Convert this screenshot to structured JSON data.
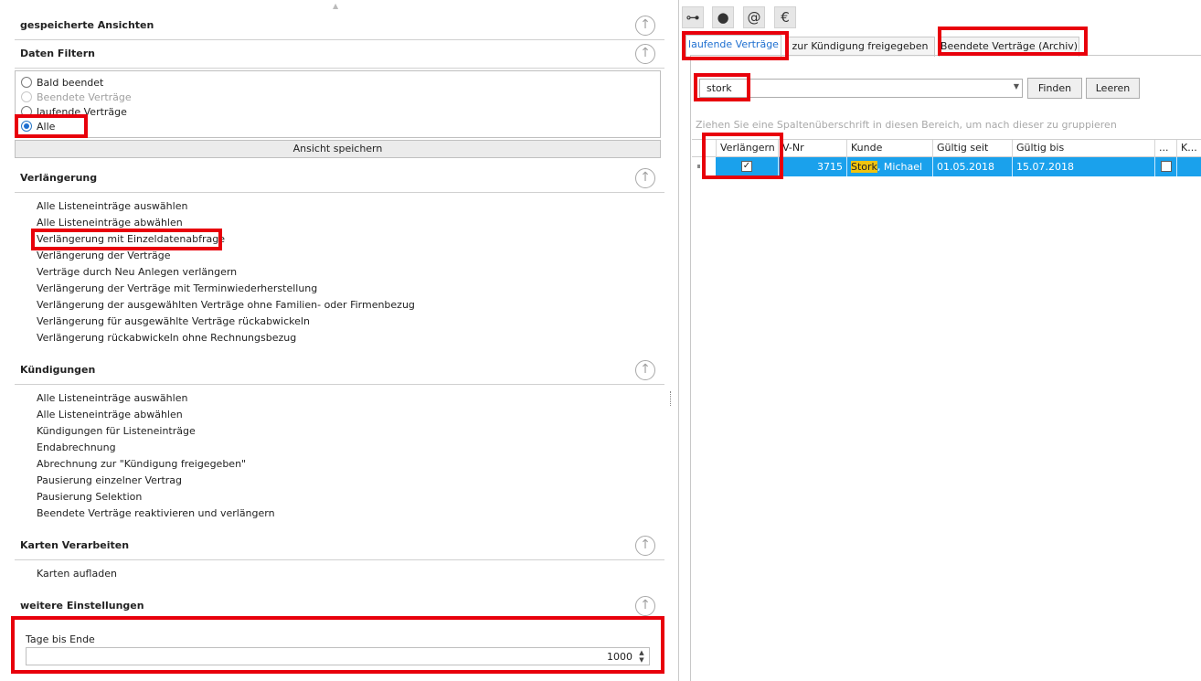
{
  "left_panel": {
    "sections": {
      "saved_views": {
        "title": "gespeicherte Ansichten"
      },
      "data_filter": {
        "title": "Daten Filtern",
        "options": [
          "Bald beendet",
          "Beendete Verträge",
          "laufende Verträge",
          "Alle"
        ],
        "selected": "Alle",
        "disabled": [
          "Beendete Verträge"
        ],
        "save_view_label": "Ansicht speichern"
      },
      "renewal": {
        "title": "Verlängerung",
        "items": [
          "Alle Listeneinträge auswählen",
          "Alle Listeneinträge abwählen",
          "Verlängerung mit Einzeldatenabfrage",
          "Verlängerung der Verträge",
          "Verträge durch Neu Anlegen verlängern",
          "Verlängerung der Verträge mit Terminwiederherstellung",
          "Verlängerung der ausgewählten Verträge ohne Familien- oder Firmenbezug",
          "Verlängerung für ausgewählte Verträge rückabwickeln",
          "Verlängerung rückabwickeln ohne Rechnungsbezug"
        ]
      },
      "cancellations": {
        "title": "Kündigungen",
        "items": [
          "Alle Listeneinträge auswählen",
          "Alle Listeneinträge abwählen",
          "Kündigungen für Listeneinträge",
          "Endabrechnung",
          "Abrechnung zur \"Kündigung freigegeben\"",
          "Pausierung einzelner Vertrag",
          "Pausierung Selektion",
          "Beendete Verträge reaktivieren und verlängern"
        ]
      },
      "cards": {
        "title": "Karten Verarbeiten",
        "items": [
          "Karten aufladen"
        ]
      },
      "more_settings": {
        "title": "weitere Einstellungen",
        "days_label": "Tage bis Ende",
        "days_value": "1000"
      }
    },
    "collapse_glyph": "↑"
  },
  "right_panel": {
    "toolbar_icons": [
      "org-chart-icon",
      "user-icon",
      "at-icon",
      "euro-icon"
    ],
    "toolbar_glyphs": [
      "⊶",
      "●",
      "@",
      "€"
    ],
    "tabs": [
      "laufende Verträge",
      "zur Kündigung freigegeben",
      "Beendete Verträge (Archiv)"
    ],
    "active_tab": "laufende Verträge",
    "search": {
      "value": "stork",
      "find_label": "Finden",
      "clear_label": "Leeren"
    },
    "group_hint": "Ziehen Sie eine Spaltenüberschrift in diesen Bereich, um nach dieser zu gruppieren",
    "grid": {
      "columns": [
        "Verlängern",
        "V-Nr",
        "Kunde",
        "Gültig seit",
        "Gültig bis",
        "...",
        "K..."
      ],
      "rows": [
        {
          "verlaengern": true,
          "vnr": "3715",
          "kunde_highlight": "Stork",
          "kunde_rest": ", Michael",
          "gueltig_seit": "01.05.2018",
          "gueltig_bis": "15.07.2018",
          "extra_checked": false
        }
      ]
    }
  },
  "colors": {
    "highlight_box": "#e8000b",
    "selected_row": "#1aa1ec",
    "search_match": "#f1c40f",
    "accent": "#1e6fd0"
  }
}
